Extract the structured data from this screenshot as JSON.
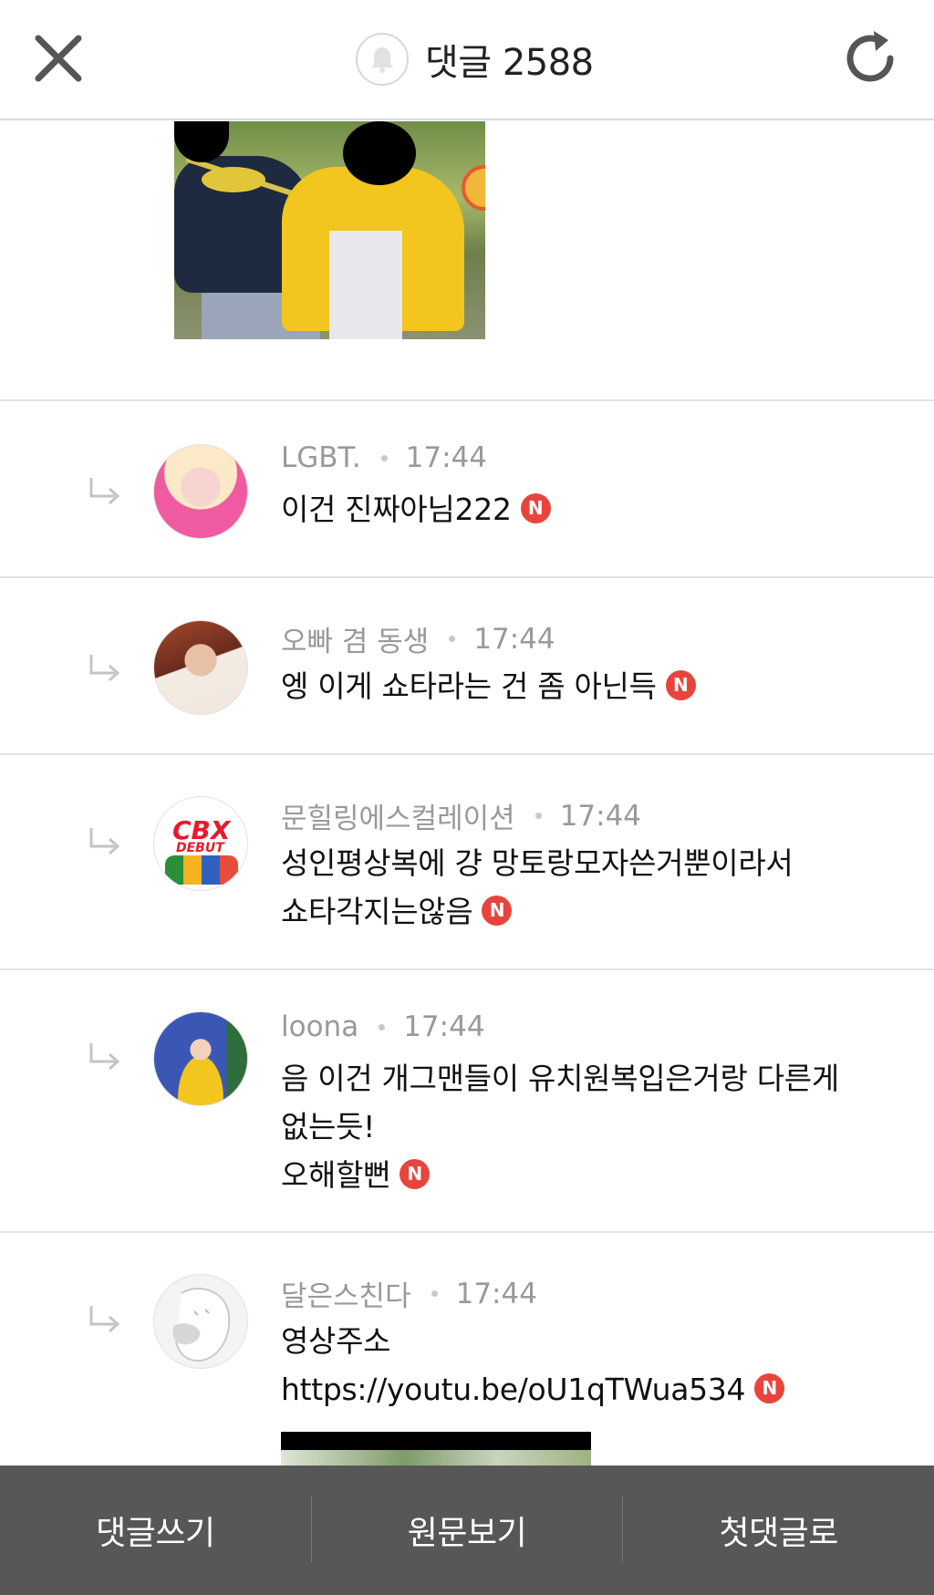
{
  "header": {
    "title": "댓글 2588",
    "close_icon": "close-icon",
    "bell_icon": "bell-icon",
    "refresh_icon": "refresh-icon"
  },
  "comments": [
    {
      "author": "LGBT.",
      "time": "17:44",
      "lines": [
        "이건 진짜아님222"
      ],
      "badge": "N"
    },
    {
      "author": "오빠 겸 동생",
      "time": "17:44",
      "lines": [
        "엥 이게 쇼타라는 건 좀 아닌득"
      ],
      "badge": "N"
    },
    {
      "author": "문힐링에스컬레이션",
      "time": "17:44",
      "lines": [
        "성인평상복에 걍 망토랑모자쓴거뿐이라서",
        "쇼타각지는않음"
      ],
      "badge": "N"
    },
    {
      "author": "loona",
      "time": "17:44",
      "lines": [
        "음 이건 개그맨들이 유치원복입은거랑 다른게",
        "없는듯!",
        "오해할뻔"
      ],
      "badge": "N"
    },
    {
      "author": "달은스친다",
      "time": "17:44",
      "lines": [
        "영상주소",
        "https://youtu.be/oU1qTWua534"
      ],
      "badge": "N"
    }
  ],
  "avatar_texts": {
    "cbx": "CBX",
    "debut": "DEBUT"
  },
  "bottom_bar": {
    "write": "댓글쓰기",
    "original": "원문보기",
    "first": "첫댓글로"
  },
  "colors": {
    "badge": "#e8443d",
    "bottom_bar": "#575757",
    "meta_text": "#999999"
  }
}
